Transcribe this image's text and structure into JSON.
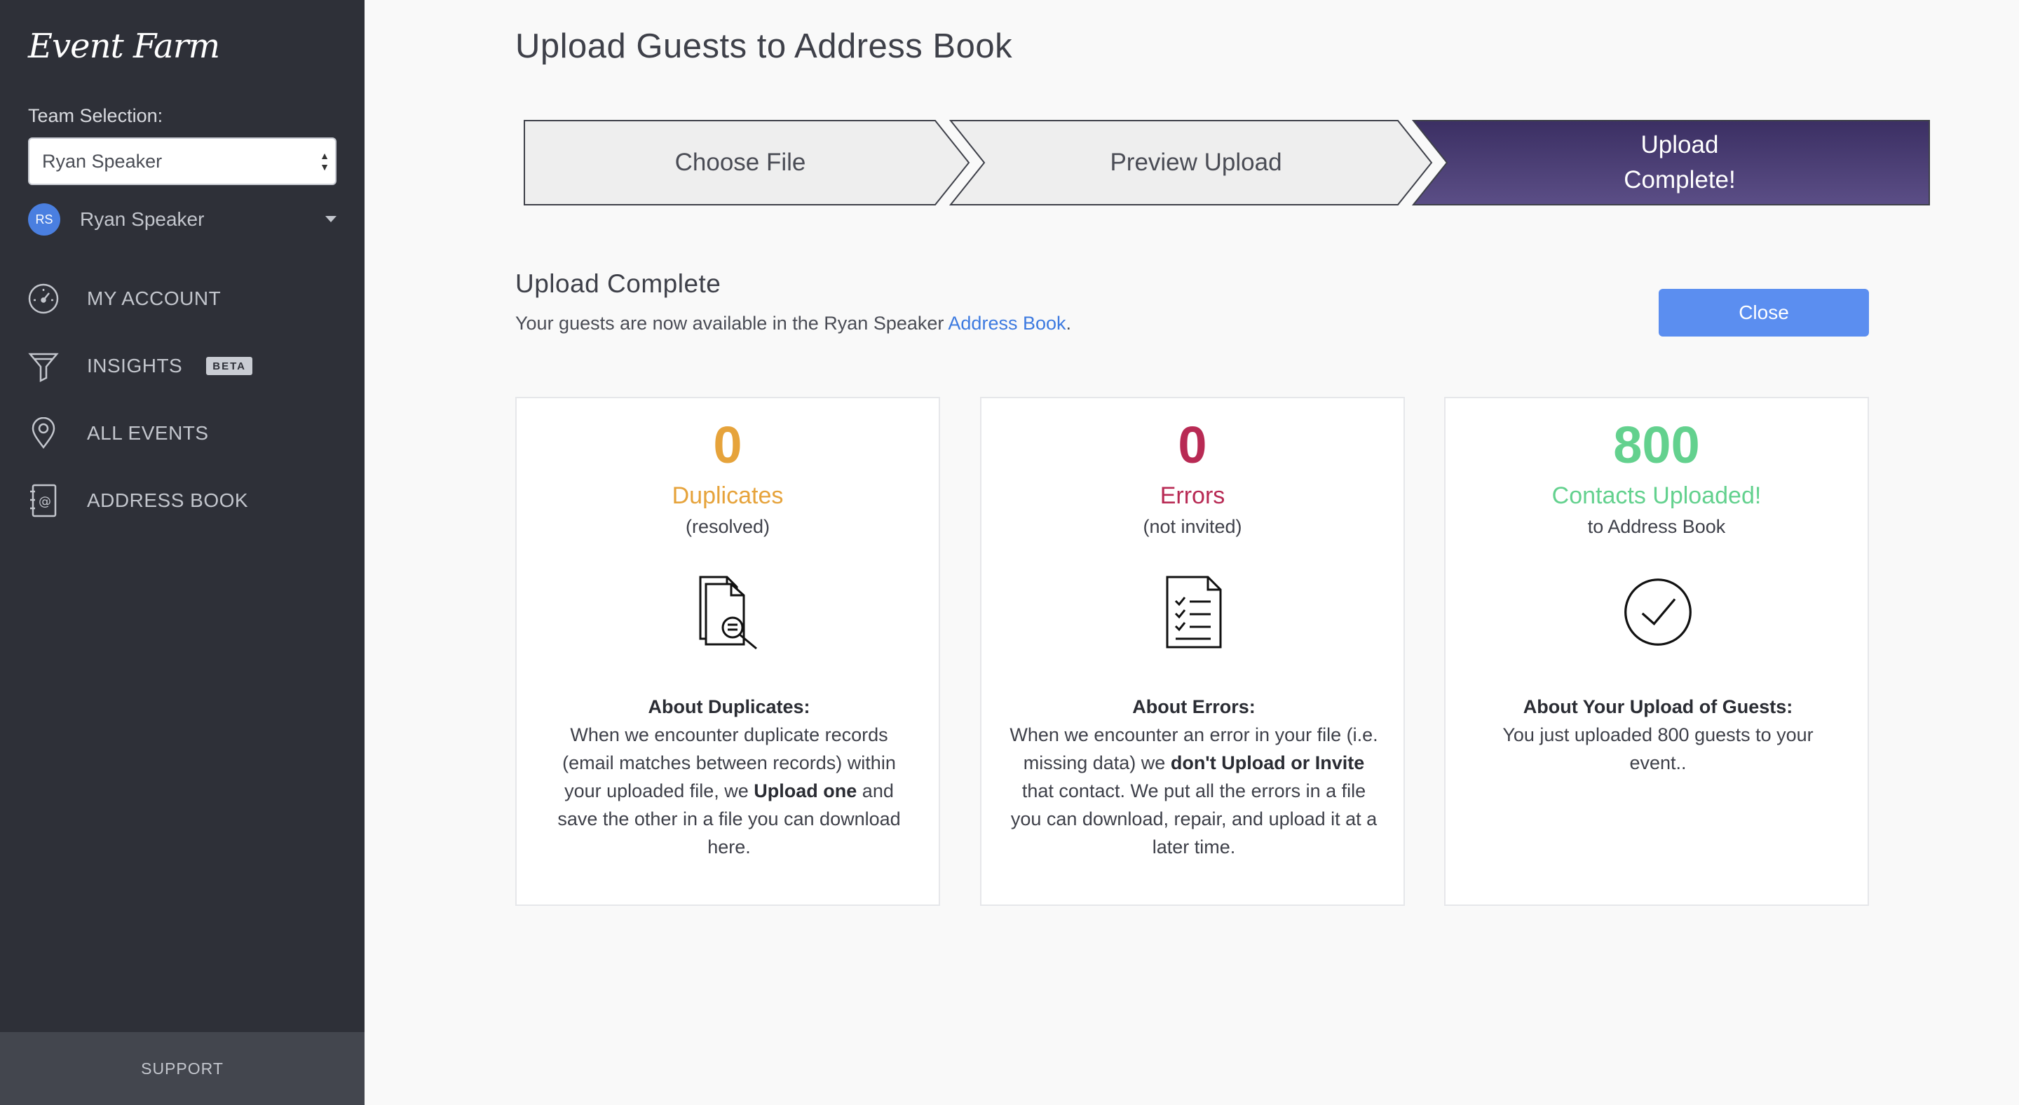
{
  "sidebar": {
    "logo": "Event Farm",
    "team_label": "Team Selection:",
    "team_selected": "Ryan Speaker",
    "user": {
      "initials": "RS",
      "name": "Ryan Speaker"
    },
    "nav": [
      {
        "label": "MY ACCOUNT",
        "icon": "speedometer-icon"
      },
      {
        "label": "INSIGHTS",
        "icon": "funnel-icon",
        "badge": "BETA"
      },
      {
        "label": "ALL EVENTS",
        "icon": "map-pin-icon"
      },
      {
        "label": "ADDRESS BOOK",
        "icon": "address-book-icon"
      }
    ],
    "support": "SUPPORT"
  },
  "main": {
    "title": "Upload Guests to Address Book",
    "steps": [
      {
        "label": "Choose File"
      },
      {
        "label": "Preview Upload"
      },
      {
        "label_line1": "Upload",
        "label_line2": "Complete!"
      }
    ],
    "section_title": "Upload Complete",
    "section_desc_prefix": "Your guests are now available in the Ryan Speaker ",
    "section_desc_link": "Address Book",
    "section_desc_suffix": ".",
    "close_label": "Close",
    "cards": [
      {
        "number": "0",
        "label": "Duplicates",
        "sub": "(resolved)",
        "icon": "document-search-icon",
        "about_title": "About Duplicates:",
        "about_p1": "When we encounter duplicate records (email matches between records) within your uploaded file, we ",
        "about_bold": "Upload one",
        "about_p2": " and save the other in a file you can download here."
      },
      {
        "number": "0",
        "label": "Errors",
        "sub": "(not invited)",
        "icon": "checklist-icon",
        "about_title": "About Errors:",
        "about_p1": "When we encounter an error in your file (i.e. missing data) we ",
        "about_bold": "don't Upload or Invite",
        "about_p2": " that contact. We put all the errors in a file you can download, repair, and upload it at a later time."
      },
      {
        "number": "800",
        "label": "Contacts Uploaded!",
        "sub": "to Address Book",
        "icon": "check-circle-icon",
        "about_title": "About Your Upload of Guests:",
        "about_p1": "You just uploaded 800 guests to your event.."
      }
    ]
  },
  "colors": {
    "sidebar_bg": "#2e3038",
    "accent_blue": "#5b8ef0",
    "step_active": "#4a3f74",
    "duplicates": "#e6a33b",
    "errors": "#b82a54",
    "uploaded": "#63d18e"
  }
}
